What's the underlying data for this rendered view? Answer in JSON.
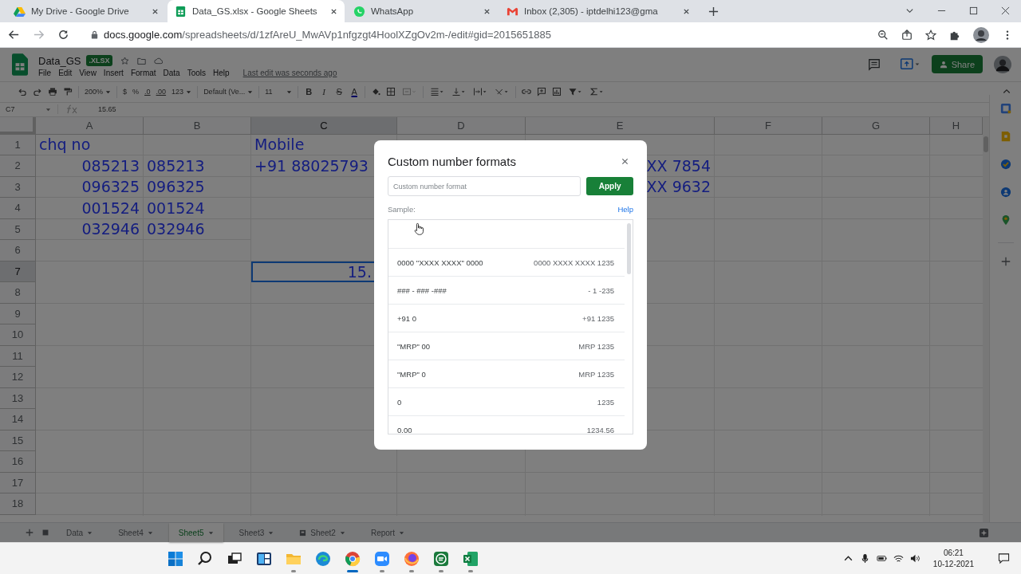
{
  "browser": {
    "tabs": [
      {
        "title": "My Drive - Google Drive",
        "selected": false,
        "kind": "drive"
      },
      {
        "title": "Data_GS.xlsx - Google Sheets",
        "selected": true,
        "kind": "sheets"
      },
      {
        "title": "WhatsApp",
        "selected": false,
        "kind": "whatsapp"
      },
      {
        "title": "Inbox (2,305) - iptdelhi123@gma",
        "selected": false,
        "kind": "gmail"
      }
    ],
    "url": "docs.google.com/spreadsheets/d/1zfAreU_MwAVp1nfgzgt4HoolXZgOv2m-/edit#gid=2015651885"
  },
  "doc": {
    "title": "Data_GS",
    "badge": ".XLSX",
    "menus": [
      "File",
      "Edit",
      "View",
      "Insert",
      "Format",
      "Data",
      "Tools",
      "Help"
    ],
    "last_edit": "Last edit was seconds ago",
    "share": "Share"
  },
  "toolbar": {
    "zoom": "200%",
    "currency": "$",
    "percent": "%",
    "decimal_less": ".0",
    "decimal_more": ".00",
    "number_formats": "123",
    "font": "Default (Ve...",
    "font_size": "11",
    "bold": "B",
    "italic": "I",
    "strikethrough": "S",
    "text_color": "A"
  },
  "formula_bar": {
    "cell_ref": "C7",
    "value": "15.65"
  },
  "grid": {
    "columns": [
      {
        "label": "A",
        "selected": false
      },
      {
        "label": "B",
        "selected": false
      },
      {
        "label": "C",
        "selected": true
      },
      {
        "label": "D",
        "selected": false
      },
      {
        "label": "E",
        "selected": false
      },
      {
        "label": "F",
        "selected": false
      },
      {
        "label": "G",
        "selected": false
      },
      {
        "label": "H",
        "selected": false
      }
    ],
    "rows": [
      {
        "label": "1",
        "selected": false,
        "cells": {
          "A": {
            "text": "chq no",
            "kind": "text",
            "selected": false
          },
          "C": {
            "text": "Mobile",
            "kind": "text",
            "selected": false
          }
        }
      },
      {
        "label": "2",
        "selected": false,
        "cells": {
          "A": {
            "text": "085213",
            "kind": "number",
            "selected": false
          },
          "B": {
            "text": "085213",
            "kind": "text",
            "selected": false
          },
          "C": {
            "text": "+91 88025793",
            "kind": "text",
            "selected": false
          },
          "E": {
            "text": "XX 7854",
            "kind": "number",
            "selected": false
          }
        }
      },
      {
        "label": "3",
        "selected": false,
        "cells": {
          "A": {
            "text": "096325",
            "kind": "number",
            "selected": false
          },
          "B": {
            "text": "096325",
            "kind": "text",
            "selected": false
          },
          "E": {
            "text": "XX 9632",
            "kind": "number",
            "selected": false
          }
        }
      },
      {
        "label": "4",
        "selected": false,
        "cells": {
          "A": {
            "text": "001524",
            "kind": "number",
            "selected": false
          },
          "B": {
            "text": "001524",
            "kind": "text",
            "selected": false
          }
        }
      },
      {
        "label": "5",
        "selected": false,
        "cells": {
          "A": {
            "text": "032946",
            "kind": "number",
            "selected": false
          },
          "B": {
            "text": "032946",
            "kind": "text",
            "selected": false
          }
        }
      },
      {
        "label": "6",
        "selected": false
      },
      {
        "label": "7",
        "selected": true,
        "cells": {
          "C": {
            "text": "15.",
            "kind": "number",
            "selected": true
          }
        }
      },
      {
        "label": "8",
        "selected": false
      },
      {
        "label": "9",
        "selected": false
      },
      {
        "label": "10",
        "selected": false
      },
      {
        "label": "11",
        "selected": false
      },
      {
        "label": "12",
        "selected": false
      },
      {
        "label": "13",
        "selected": false
      },
      {
        "label": "14",
        "selected": false
      },
      {
        "label": "15",
        "selected": false
      },
      {
        "label": "16",
        "selected": false
      },
      {
        "label": "17",
        "selected": false
      },
      {
        "label": "18",
        "selected": false
      }
    ]
  },
  "sheet_tabs": [
    {
      "label": "Data",
      "selected": false,
      "kind": "plain"
    },
    {
      "label": "Sheet4",
      "selected": false,
      "kind": "plain"
    },
    {
      "label": "Sheet5",
      "selected": true,
      "kind": "plain"
    },
    {
      "label": "Sheet3",
      "selected": false,
      "kind": "plain"
    },
    {
      "label": "Sheet2",
      "selected": false,
      "kind": "linked"
    },
    {
      "label": "Report",
      "selected": false,
      "kind": "plain"
    }
  ],
  "dialog": {
    "title": "Custom number formats",
    "input": {
      "placeholder": "Custom number format"
    },
    "apply": "Apply",
    "sample_label": "Sample:",
    "help": "Help",
    "formats": [
      {
        "pattern": "0000 \"XXXX XXXX\" 0000",
        "sample": "0000 XXXX XXXX 1235"
      },
      {
        "pattern": "### - ### -###",
        "sample": "- 1 -235"
      },
      {
        "pattern": "+91 0",
        "sample": "+91 1235"
      },
      {
        "pattern": "\"MRP\" 00",
        "sample": "MRP 1235"
      },
      {
        "pattern": "\"MRP\" 0",
        "sample": "MRP 1235"
      },
      {
        "pattern": "0",
        "sample": "1235"
      },
      {
        "pattern": "0.00",
        "sample": "1234.56"
      }
    ]
  },
  "taskbar": {
    "time": "06:21",
    "date": "10-12-2021"
  }
}
